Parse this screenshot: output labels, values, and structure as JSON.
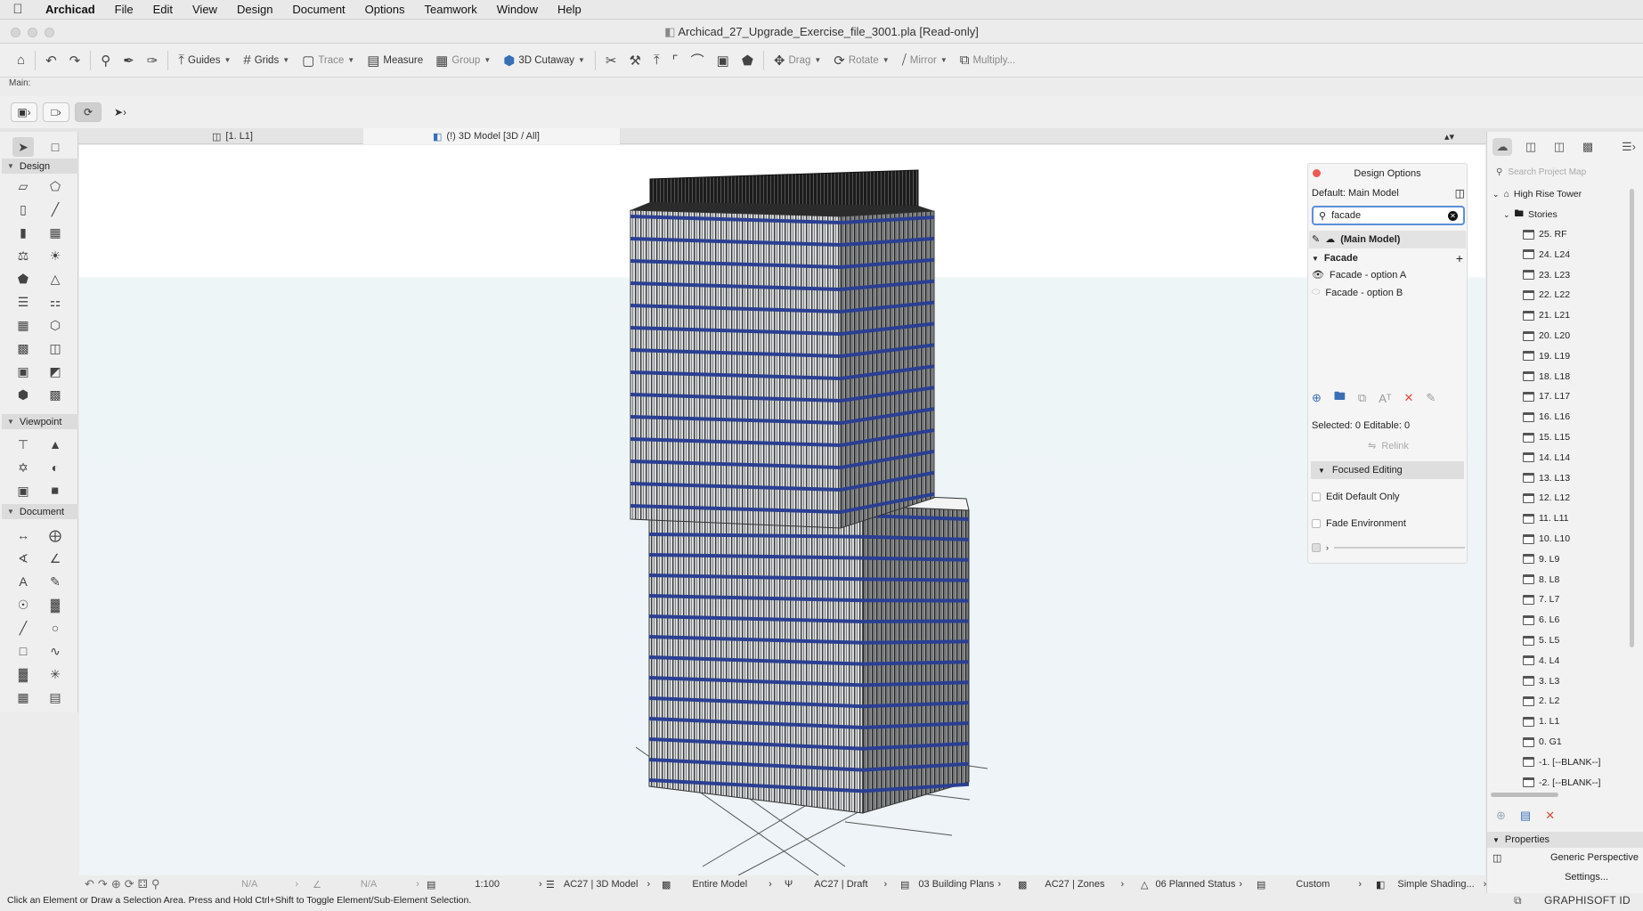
{
  "menubar": {
    "items": [
      "Archicad",
      "File",
      "Edit",
      "View",
      "Design",
      "Document",
      "Options",
      "Teamwork",
      "Window",
      "Help"
    ]
  },
  "window": {
    "title": "Archicad_27_Upgrade_Exercise_file_3001.pla [Read-only]"
  },
  "toolbar": {
    "guides": "Guides",
    "grids": "Grids",
    "trace": "Trace",
    "measure": "Measure",
    "group": "Group",
    "cutaway": "3D Cutaway",
    "drag": "Drag",
    "rotate": "Rotate",
    "mirror": "Mirror",
    "multiply": "Multiply..."
  },
  "infobox": {
    "label": "Main:"
  },
  "tabs": [
    {
      "label": "[1. L1]"
    },
    {
      "label": "(!) 3D Model [3D / All]"
    }
  ],
  "toolbox": {
    "sections": [
      "Design",
      "Viewpoint",
      "Document"
    ]
  },
  "design_options": {
    "title": "Design Options",
    "default_label": "Default: Main Model",
    "search_value": "facade",
    "main_model": "(Main Model)",
    "set_name": "Facade",
    "options": [
      "Facade - option A",
      "Facade - option B"
    ],
    "selected_info": "Selected: 0 Editable: 0",
    "relink": "Relink",
    "focused_section": "Focused Editing",
    "edit_default_only": "Edit Default Only",
    "fade_environment": "Fade Environment"
  },
  "navigator": {
    "search_placeholder": "Search Project Map",
    "project": "High Rise Tower",
    "stories_folder": "Stories",
    "stories": [
      "25. RF",
      "24. L24",
      "23. L23",
      "22. L22",
      "21. L21",
      "20. L20",
      "19. L19",
      "18. L18",
      "17. L17",
      "16. L16",
      "15. L15",
      "14. L14",
      "13. L13",
      "12. L12",
      "11. L11",
      "10. L10",
      "9. L9",
      "8. L8",
      "7. L7",
      "6. L6",
      "5. L5",
      "4. L4",
      "3. L3",
      "2. L2",
      "1. L1",
      "0. G1",
      "-1. [--BLANK--]",
      "-2. [--BLANK--]"
    ],
    "properties_title": "Properties",
    "perspective": "Generic Perspective",
    "settings": "Settings..."
  },
  "statusbar": {
    "na1": "N/A",
    "na2": "N/A",
    "scale": "1:100",
    "layer": "AC27 | 3D Model",
    "model": "Entire Model",
    "pen": "AC27 | Draft",
    "mvo": "03 Building Plans",
    "zones": "AC27 | Zones",
    "renovation": "06 Planned Status",
    "dimension": "Custom",
    "shading": "Simple Shading..."
  },
  "hint": "Click an Element or Draw a Selection Area. Press and Hold Ctrl+Shift to Toggle Element/Sub-Element Selection.",
  "brand": "GRAPHISOFT ID",
  "colors": {
    "accent": "#5b8ed8",
    "glass_band": "#2a3f93",
    "close": "#ec5b56"
  }
}
